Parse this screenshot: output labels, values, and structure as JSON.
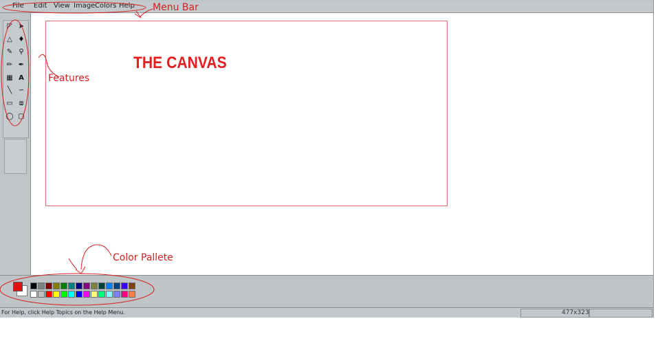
{
  "menu": {
    "items": [
      {
        "label": "File"
      },
      {
        "label": "Edit"
      },
      {
        "label": "View"
      },
      {
        "label": "Image"
      },
      {
        "label": "Colors"
      },
      {
        "label": "Help"
      }
    ]
  },
  "canvas": {
    "label": "THE CANVAS"
  },
  "annotations": {
    "menu_bar": "Menu Bar",
    "features": "Features",
    "color_palette": "Color Pallete"
  },
  "status": {
    "help_text": "For Help, click Help Topics on the Help Menu.",
    "canvas_size": "477x323"
  },
  "colors": {
    "foreground": "#e01010",
    "background": "#ffffff",
    "palette_top": [
      "#000000",
      "#808080",
      "#800000",
      "#808000",
      "#008000",
      "#008080",
      "#000080",
      "#800080",
      "#808040",
      "#004040",
      "#0080ff",
      "#004080",
      "#4000ff",
      "#804000"
    ],
    "palette_bottom": [
      "#ffffff",
      "#c0c0c0",
      "#ff0000",
      "#ffff00",
      "#00ff00",
      "#00ffff",
      "#0000ff",
      "#ff00ff",
      "#ffff80",
      "#00ff80",
      "#80ffff",
      "#8080ff",
      "#ff0080",
      "#ff8040"
    ]
  }
}
